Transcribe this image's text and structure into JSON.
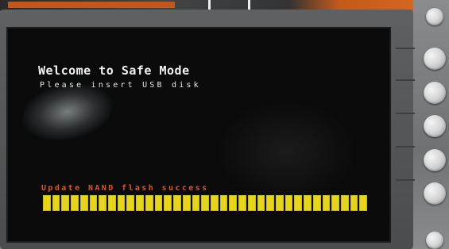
{
  "screen": {
    "title": "Welcome to Safe Mode",
    "subtitle": "Please insert USB disk",
    "status": "Update NAND flash success",
    "progress": {
      "value": 1.0,
      "segments": 35,
      "color": "#e6d61a"
    }
  },
  "colors": {
    "title_text": "#f2f2f2",
    "status_text": "#e0541e",
    "screen_bg": "#0a0a0a",
    "bezel": "#5e6061",
    "accent_strip": "#c1571a"
  },
  "side_buttons": [
    {
      "icon": "round-button-icon"
    },
    {
      "icon": "round-button-icon"
    },
    {
      "icon": "round-button-icon"
    },
    {
      "icon": "round-button-icon"
    },
    {
      "icon": "round-button-icon"
    },
    {
      "icon": "round-button-icon"
    },
    {
      "icon": "round-button-icon"
    }
  ]
}
